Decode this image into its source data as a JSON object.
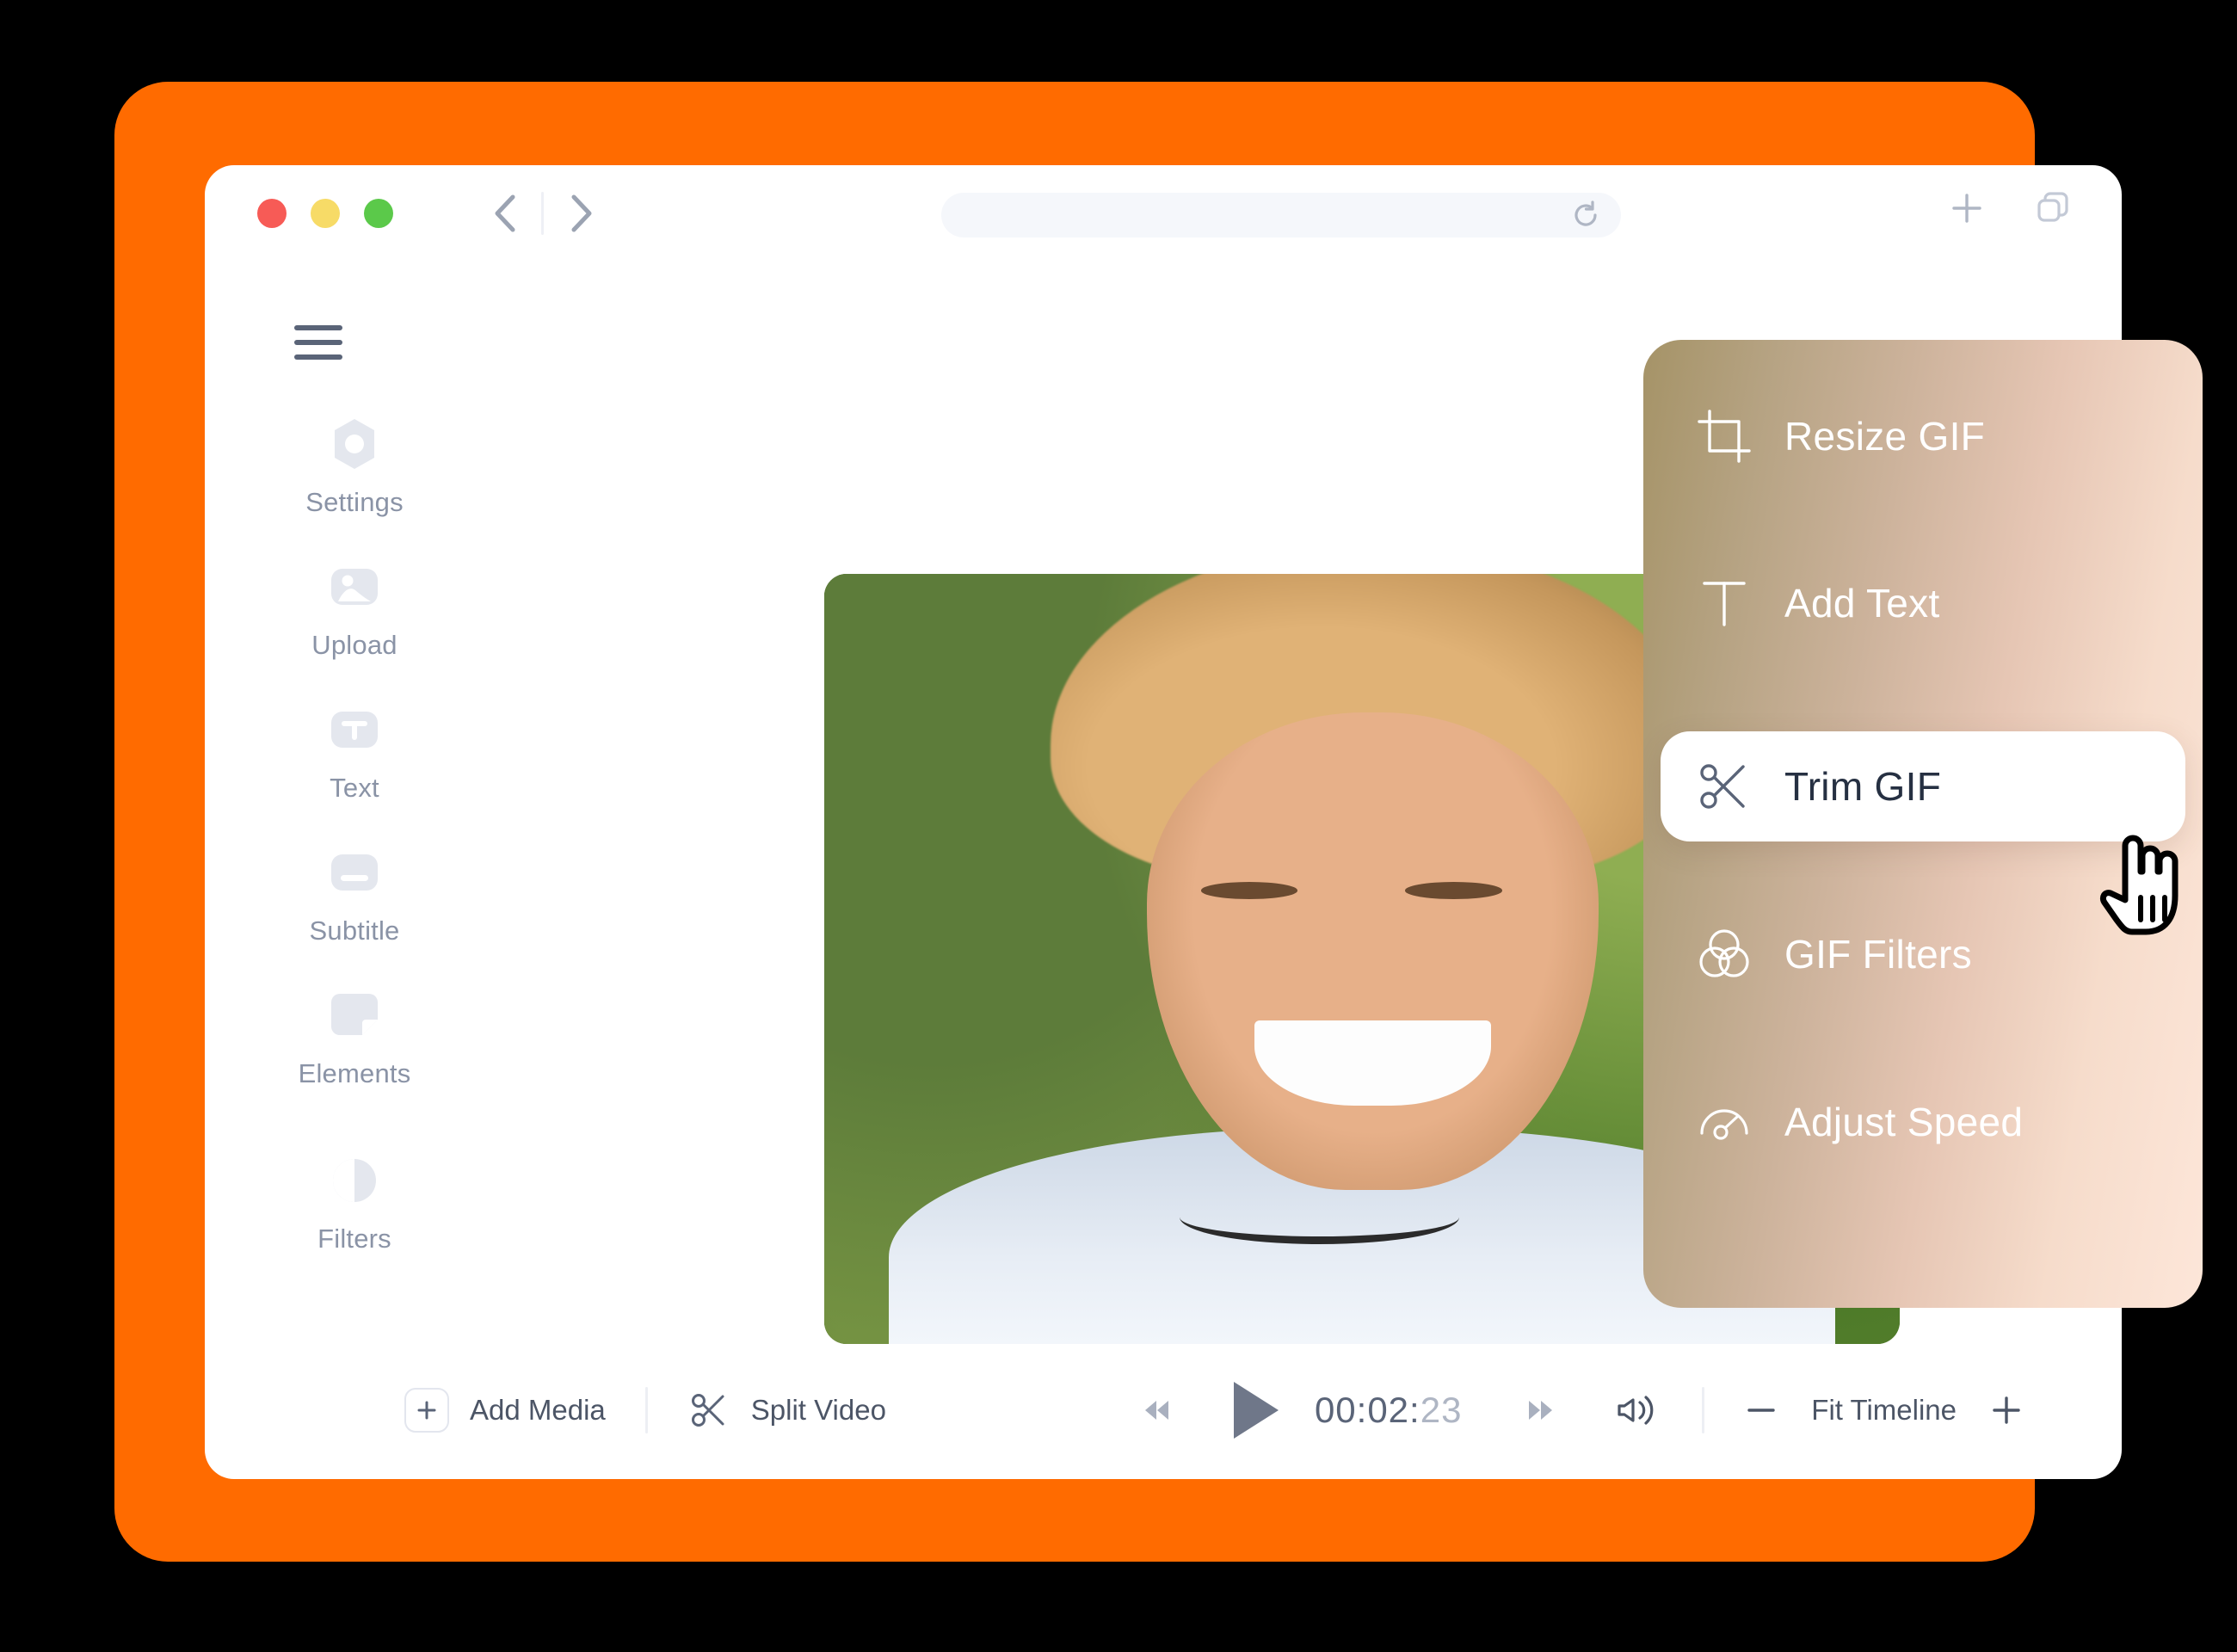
{
  "theme": {
    "brand_orange": "#FF6B00",
    "panel_gradient_from": "#a59367",
    "panel_gradient_to": "#fde6d9",
    "active_row_bg": "#FFFFFF",
    "active_row_text": "#263042",
    "sidebar_label_color": "#8A93A6",
    "toolbar_label_color": "#4C5566"
  },
  "browser": {
    "traffic_lights": [
      {
        "name": "close",
        "color": "#F75B56"
      },
      {
        "name": "minimize",
        "color": "#F7DB67"
      },
      {
        "name": "zoom",
        "color": "#5BC94A"
      }
    ],
    "back_icon": "chevron-left-icon",
    "forward_icon": "chevron-right-icon",
    "reload_icon": "reload-icon",
    "new_tab_icon": "plus-icon",
    "tabs_icon": "copy-tabs-icon",
    "url_value": "",
    "url_placeholder": ""
  },
  "sidebar": {
    "menu_icon": "hamburger-icon",
    "items": [
      {
        "label": "Settings",
        "icon": "settings-nut-icon"
      },
      {
        "label": "Upload",
        "icon": "image-upload-icon"
      },
      {
        "label": "Text",
        "icon": "text-t-icon"
      },
      {
        "label": "Subtitle",
        "icon": "subtitle-bar-icon"
      },
      {
        "label": "Elements",
        "icon": "elements-sticker-icon"
      },
      {
        "label": "Filters",
        "icon": "filters-contrast-icon"
      }
    ]
  },
  "preview": {
    "alt": "Smiling young woman laughing outdoors with green foliage background"
  },
  "toolbar": {
    "add_media_label": "Add Media",
    "add_media_icon": "plus-box-icon",
    "split_video_label": "Split Video",
    "split_video_icon": "scissors-icon",
    "rewind_icon": "rewind-icon",
    "play_icon": "play-icon",
    "forward_icon": "fast-forward-icon",
    "timecode_major": "00:02:",
    "timecode_minor": "23",
    "volume_icon": "volume-icon",
    "zoom_out_icon": "minus-icon",
    "fit_timeline_label": "Fit Timeline",
    "zoom_in_icon": "plus-icon"
  },
  "gif_menu": {
    "items": [
      {
        "label": "Resize GIF",
        "icon": "crop-icon",
        "active": false
      },
      {
        "label": "Add Text",
        "icon": "text-t-icon",
        "active": false
      },
      {
        "label": "Trim GIF",
        "icon": "scissors-icon",
        "active": true
      },
      {
        "label": "GIF Filters",
        "icon": "venn-circles-icon",
        "active": false
      },
      {
        "label": "Adjust Speed",
        "icon": "speedometer-icon",
        "active": false
      }
    ]
  },
  "cursor": {
    "icon": "pointing-hand-cursor",
    "over_item": "Trim GIF"
  }
}
